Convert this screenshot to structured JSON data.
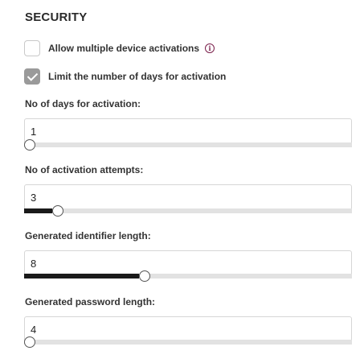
{
  "section": {
    "title": "SECURITY"
  },
  "options": {
    "multiple_devices": {
      "label": "Allow multiple device activations",
      "checked": false,
      "info_icon": "info-icon"
    },
    "limit_days": {
      "label": "Limit the number of days for activation",
      "checked": true
    }
  },
  "fields": [
    {
      "label": "No of days for activation:",
      "value": "1",
      "slider_fraction": 0.0
    },
    {
      "label": "No of activation attempts:",
      "value": "3",
      "slider_fraction": 0.085
    },
    {
      "label": "Generated identifier length:",
      "value": "8",
      "slider_fraction": 0.35
    },
    {
      "label": "Generated password length:",
      "value": "4",
      "slider_fraction": 0.0
    }
  ],
  "colors": {
    "info_accent": "#7a1f4b",
    "checkbox_checked": "#9a9a9a",
    "slider_fill": "#1a1a1a",
    "slider_track": "#e2e2e2"
  }
}
